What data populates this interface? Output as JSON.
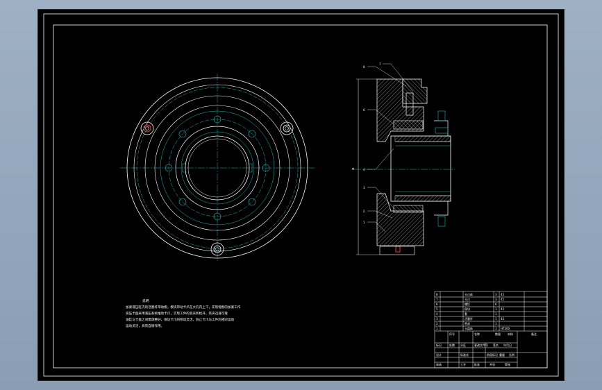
{
  "colors": {
    "background": "#8fa2b7",
    "sheet": "#000000",
    "line": "#ffffff",
    "center_line": "#1fb8b8",
    "highlight": "#e23b3b"
  },
  "notes": {
    "title": "说明",
    "lines": [
      "加紧液压缸内的活塞杆带动楔，楔块带动卡爪在大孔内上下，实现镗削的加紧工作",
      "液压卡盘采用液压系统推动卡爪，实现工件的装夹和松开，装夹迅速可靠",
      "油缸与卡盘之间需调整好，保证卡爪的移动灵活，防止卡爪与工件的相对运动",
      "运动灵活，具有自锁作用。"
    ]
  },
  "callouts": [
    "8",
    "7",
    "6",
    "4",
    "3",
    "2",
    "1"
  ],
  "dimension_label": "Φ",
  "title_block": {
    "bom_rows": [
      [
        "8",
        "卡爪体",
        "3",
        "45"
      ],
      [
        "7",
        "卡爪",
        "3",
        "45"
      ],
      [
        "6",
        "螺钉",
        "6",
        ""
      ],
      [
        "5",
        "楔块",
        "1",
        "45"
      ],
      [
        "4",
        "套",
        "1",
        ""
      ],
      [
        "3",
        "活塞杆",
        "1",
        "45"
      ],
      [
        "2",
        "密封",
        "1",
        ""
      ],
      [
        "1",
        "卡盘体",
        "1",
        "HT200"
      ]
    ],
    "bom_header": [
      "序号",
      "名称",
      "数量",
      "材料",
      "备注"
    ],
    "mid_labels": [
      "标记",
      "处数",
      "分区",
      "更改文件号",
      "签名",
      "年月日"
    ],
    "lower_labels": [
      "设计",
      "标准化",
      "阶段标记",
      "重量",
      "比例"
    ],
    "bottom_labels": [
      "审核",
      "工艺",
      "批准",
      "共张",
      "第张"
    ]
  }
}
